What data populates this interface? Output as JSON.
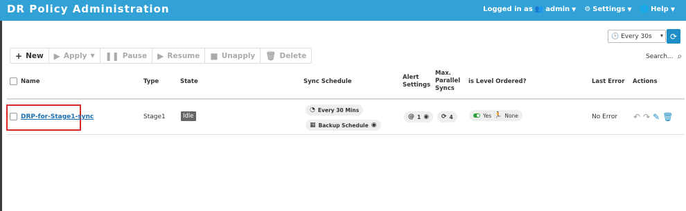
{
  "header": {
    "title": "DR Policy Administration",
    "logged_in_prefix": "Logged in as",
    "user": "admin",
    "settings": "Settings",
    "help": "Help"
  },
  "refresh": {
    "selected": "Every 30s"
  },
  "toolbar": {
    "new": "New",
    "apply": "Apply",
    "pause": "Pause",
    "resume": "Resume",
    "unapply": "Unapply",
    "delete": "Delete"
  },
  "search": {
    "label": "Search..."
  },
  "table": {
    "headers": {
      "name": "Name",
      "type": "Type",
      "state": "State",
      "sync_schedule": "Sync Schedule",
      "alert_settings_1": "Alert",
      "alert_settings_2": "Settings",
      "max_parallel_1": "Max.",
      "max_parallel_2": "Parallel",
      "max_parallel_3": "Syncs",
      "level_ordered": "is Level Ordered?",
      "last_error": "Last Error",
      "actions": "Actions"
    },
    "rows": [
      {
        "name": "DRP-for-Stage1-sync",
        "type": "Stage1",
        "state": "Idle",
        "schedule": "Every 30 Mins",
        "backup_schedule": "Backup Schedule",
        "alert_count": "1",
        "max_parallel": "4",
        "level_ordered_yes": "Yes",
        "level_ordered_none": "None",
        "last_error": "No Error"
      }
    ]
  },
  "colors": {
    "topbar": "#31a1d6",
    "accent": "#1e8fc6",
    "highlight": "#d62828"
  }
}
